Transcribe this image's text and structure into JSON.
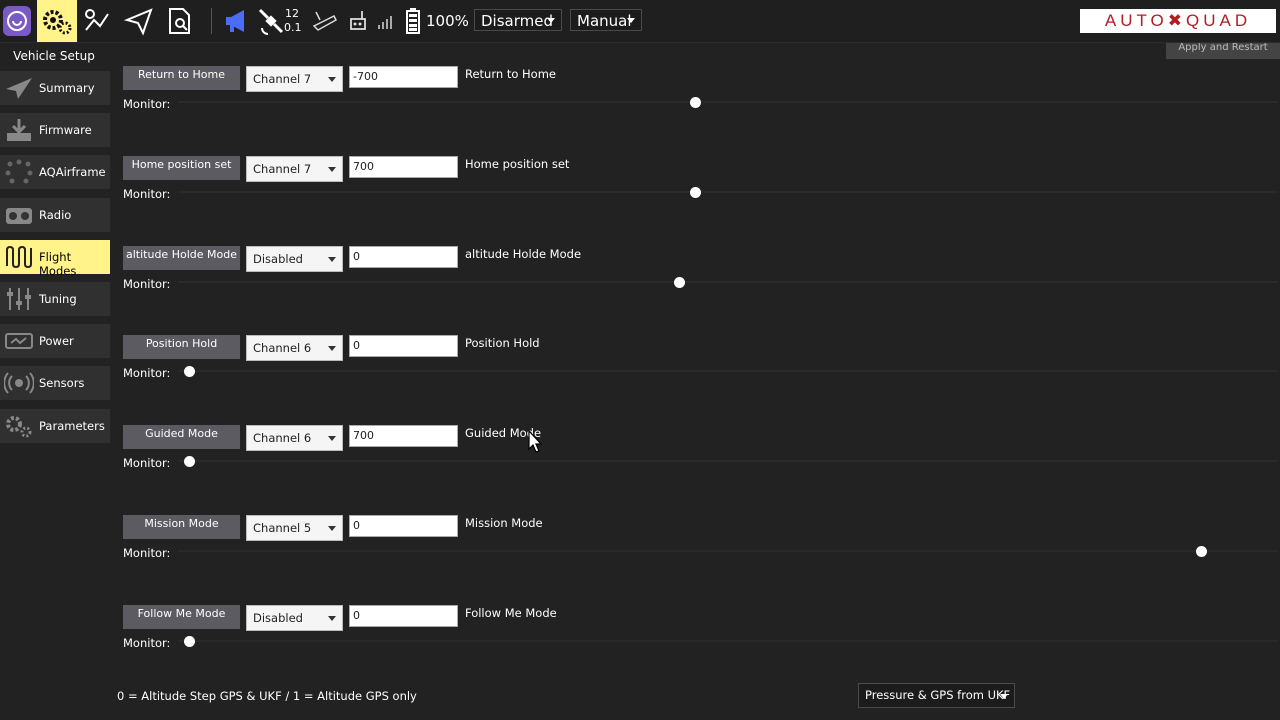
{
  "toolbar": {
    "gps_count": "12",
    "gps_hdop": "0.1",
    "battery": "100%",
    "arm_state": "Disarmed",
    "flight_mode": "Manual",
    "brand": "AUTO✖QUAD",
    "icons": [
      "app-logo-icon",
      "gear-icon",
      "plan-icon",
      "send-icon",
      "analyze-icon",
      "megaphone-icon",
      "satellite-icon",
      "rc-signal-icon",
      "telemetry-icon",
      "signal-bars-icon",
      "battery-icon"
    ]
  },
  "apply_button": "Apply and Restart",
  "sidebar": {
    "title": "Vehicle Setup",
    "items": [
      {
        "label": "Summary",
        "icon": "paper-plane-icon",
        "active": false
      },
      {
        "label": "Firmware",
        "icon": "download-icon",
        "active": false
      },
      {
        "label": "AQAirframe",
        "icon": "airframe-icon",
        "active": false
      },
      {
        "label": "Radio",
        "icon": "radio-icon",
        "active": false
      },
      {
        "label": "Flight Modes",
        "icon": "waveform-icon",
        "active": true
      },
      {
        "label": "Tuning",
        "icon": "sliders-icon",
        "active": false
      },
      {
        "label": "Power",
        "icon": "power-icon",
        "active": false
      },
      {
        "label": "Sensors",
        "icon": "sensors-icon",
        "active": false
      },
      {
        "label": "Parameters",
        "icon": "gears-icon",
        "active": false
      }
    ]
  },
  "modes": [
    {
      "button": "Return to Home",
      "channel": "Channel 7",
      "value": "-700",
      "desc": "Return to Home",
      "monitor_label": "Monitor:",
      "monitor_level": 0.47
    },
    {
      "button": "Home position set",
      "channel": "Channel 7",
      "value": "700",
      "desc": "Home position set",
      "monitor_label": "Monitor:",
      "monitor_level": 0.47
    },
    {
      "button": "altitude Holde Mode",
      "channel": "Disabled",
      "value": "0",
      "desc": "altitude Holde Mode",
      "monitor_label": "Monitor:",
      "monitor_level": 0.455
    },
    {
      "button": "Position Hold",
      "channel": "Channel 6",
      "value": "0",
      "desc": "Position Hold",
      "monitor_label": "Monitor:",
      "monitor_level": 0.01
    },
    {
      "button": "Guided Mode",
      "channel": "Channel 6",
      "value": "700",
      "desc": "Guided Mode",
      "monitor_label": "Monitor:",
      "monitor_level": 0.01
    },
    {
      "button": "Mission Mode",
      "channel": "Channel 5",
      "value": "0",
      "desc": "Mission Mode",
      "monitor_label": "Monitor:",
      "monitor_level": 0.93
    },
    {
      "button": "Follow Me Mode",
      "channel": "Disabled",
      "value": "0",
      "desc": "Follow Me Mode",
      "monitor_label": "Monitor:",
      "monitor_level": 0.01
    }
  ],
  "footer": {
    "note": "0 = Altitude Step GPS & UKF / 1 = Altitude GPS only",
    "source": "Pressure & GPS from UKF"
  },
  "colors": {
    "active": "#fff38a",
    "button": "#5c5b62",
    "brand": "#b01e23",
    "accent": "#4a6cf7"
  }
}
